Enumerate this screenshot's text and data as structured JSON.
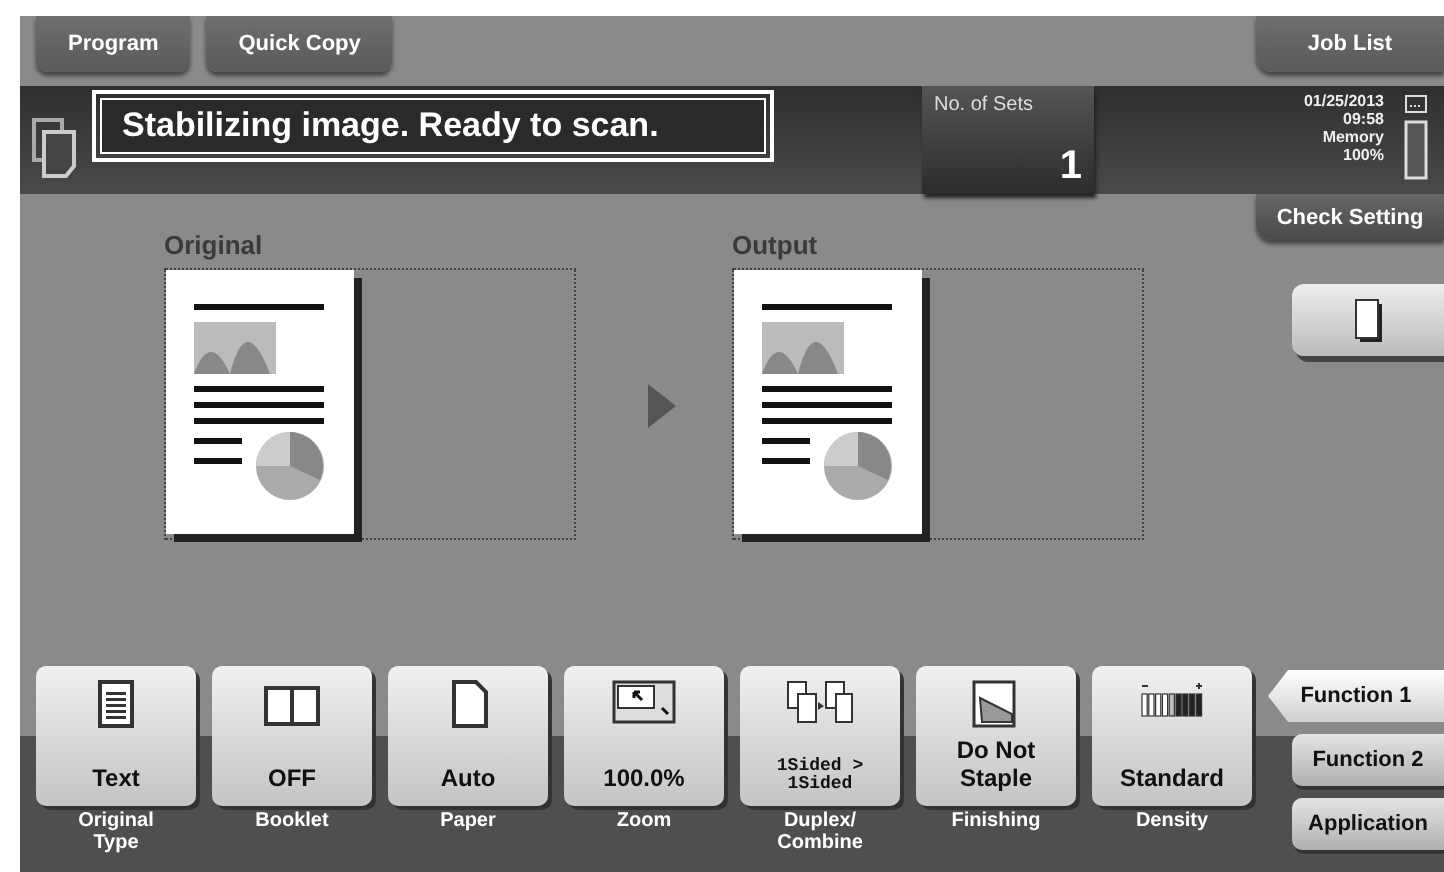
{
  "top_tabs": [
    {
      "label": "Program"
    },
    {
      "label": "Quick Copy"
    }
  ],
  "job_list": {
    "label": "Job List"
  },
  "message": "Stabilizing image. Ready to scan.",
  "sets": {
    "label": "No. of Sets",
    "value": "1"
  },
  "status": {
    "date": "01/25/2013",
    "time": "09:58",
    "memory_label": "Memory",
    "memory_value": "100%"
  },
  "check_setting": {
    "label": "Check Setting"
  },
  "original": {
    "label": "Original"
  },
  "output": {
    "label": "Output"
  },
  "settings": [
    {
      "kind": "text",
      "value": "Text",
      "label": "Original Type"
    },
    {
      "kind": "booklet",
      "value": "OFF",
      "label": "Booklet"
    },
    {
      "kind": "paper",
      "value": "Auto",
      "label": "Paper"
    },
    {
      "kind": "zoom",
      "value": "100.0%",
      "label": "Zoom"
    },
    {
      "kind": "duplex",
      "value": "1Sided > 1Sided",
      "label": "Duplex/ Combine"
    },
    {
      "kind": "finishing",
      "value": "Do Not Staple",
      "label": "Finishing"
    },
    {
      "kind": "density",
      "value": "Standard",
      "label": "Density"
    }
  ],
  "function_tabs": [
    {
      "label": "Function 1",
      "selected": true
    },
    {
      "label": "Function 2",
      "selected": false
    },
    {
      "label": "Application",
      "selected": false
    }
  ]
}
